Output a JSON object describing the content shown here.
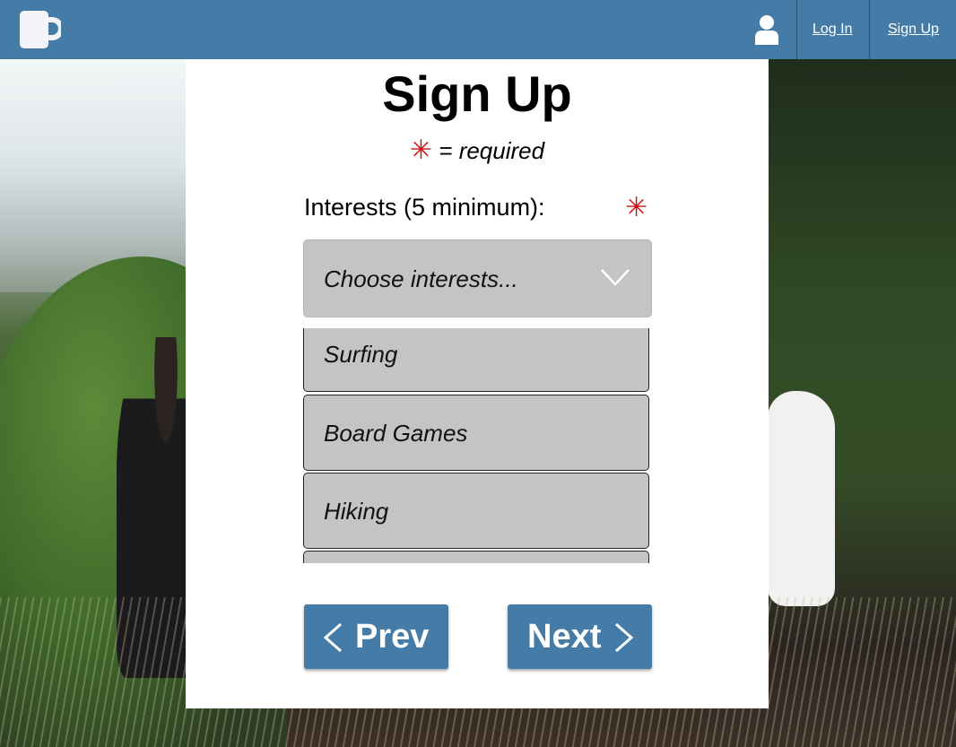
{
  "header": {
    "login_label": "Log In",
    "signup_label": "Sign Up",
    "logo_icon": "mug-icon",
    "user_icon": "user-icon",
    "bar_color": "#447ba7"
  },
  "form": {
    "title": "Sign Up",
    "required_star": "✳",
    "required_text": "= required",
    "interests_label": "Interests (5 minimum):",
    "interests_placeholder": "Choose interests...",
    "options": [
      "Surfing",
      "Board Games",
      "Hiking"
    ],
    "prev_label": "Prev",
    "next_label": "Next",
    "accent_color": "#447ba7",
    "required_color": "#d01010"
  }
}
